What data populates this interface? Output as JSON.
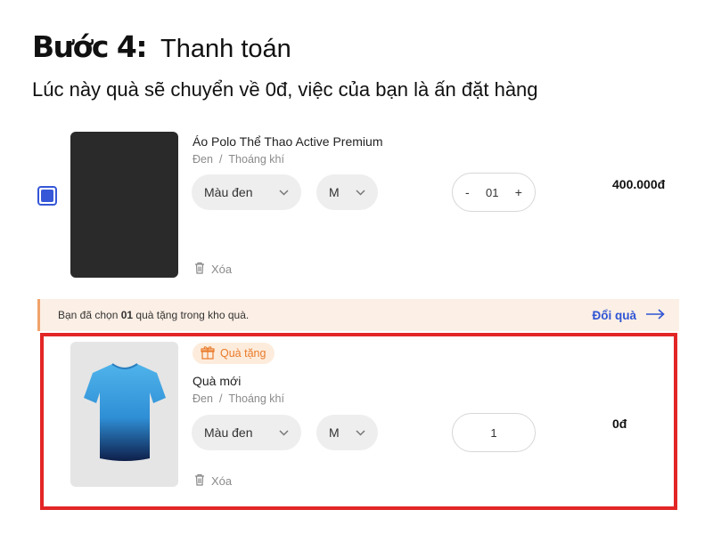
{
  "heading": {
    "step": "Bước 4:",
    "title": "Thanh toán",
    "subtitle": "Lúc này quà sẽ chuyển về 0đ, việc của bạn là ấn đặt hàng"
  },
  "cart_item": {
    "checked": true,
    "name": "Áo Polo Thể Thao Active Premium",
    "color": "Đen",
    "variant_sep": "/",
    "feature": "Thoáng khí",
    "color_select": "Màu đen",
    "size_select": "M",
    "qty_minus": "-",
    "quantity": "01",
    "qty_plus": "+",
    "price": "400.000đ",
    "delete_label": "Xóa"
  },
  "notice": {
    "prefix": "Bạn đã chọn ",
    "count": "01",
    "suffix": " quà tặng trong kho quà.",
    "change_label": "Đổi quà"
  },
  "gift_item": {
    "badge": "Quà tặng",
    "name": "Quà mới",
    "color": "Đen",
    "variant_sep": "/",
    "feature": "Thoáng khí",
    "color_select": "Màu đen",
    "size_select": "M",
    "quantity": "1",
    "price": "0đ",
    "delete_label": "Xóa"
  },
  "colors": {
    "accent_blue": "#3557d8",
    "highlight_red": "#e22626",
    "notice_bg": "#fcefe5",
    "badge_orange": "#e97a2a"
  },
  "icons": [
    "trash-icon",
    "chevron-down-icon",
    "arrow-right-icon",
    "gift-icon",
    "tshirt-image"
  ]
}
